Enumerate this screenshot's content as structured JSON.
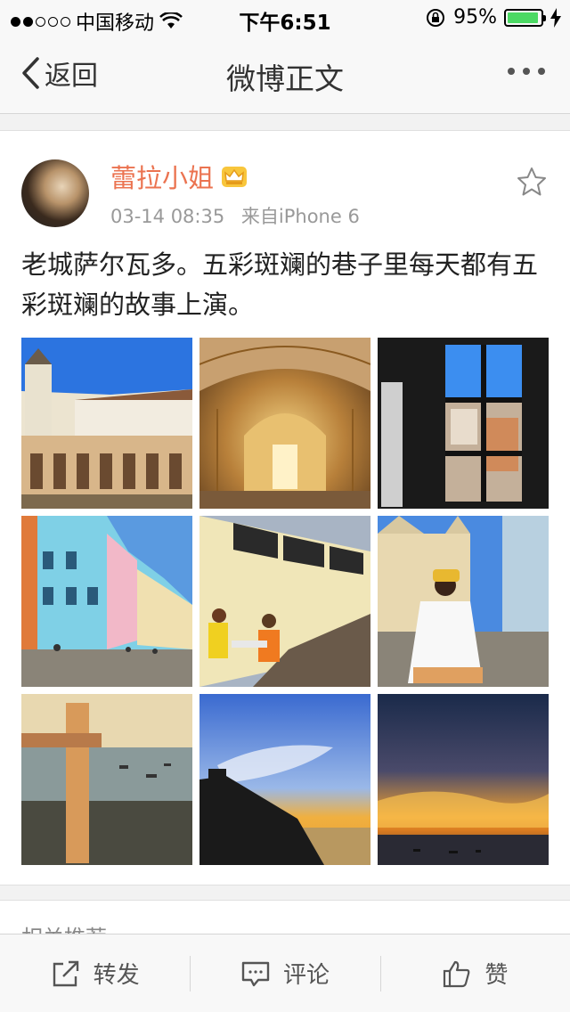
{
  "status_bar": {
    "carrier": "中国移动",
    "time": "下午6:51",
    "battery_percent": "95%",
    "battery_level": 0.95
  },
  "nav": {
    "back_label": "返回",
    "title": "微博正文"
  },
  "post": {
    "username": "蕾拉小姐",
    "date": "03-14 08:35",
    "source": "来自iPhone 6",
    "text": "老城萨尔瓦多。五彩斑斓的巷子里每天都有五彩斑斓的故事上演。",
    "photos": [
      {
        "name": "photo-colonial-church-courtyard"
      },
      {
        "name": "photo-golden-church-interior"
      },
      {
        "name": "photo-window-view"
      },
      {
        "name": "photo-colorful-street"
      },
      {
        "name": "photo-men-sitting-yellow-wall"
      },
      {
        "name": "photo-baiana-woman"
      },
      {
        "name": "photo-elevator-tower-bay"
      },
      {
        "name": "photo-sunset-coast"
      },
      {
        "name": "photo-sunset-sea"
      }
    ]
  },
  "recommend": {
    "label": "相关推荐"
  },
  "actions": {
    "repost": "转发",
    "comment": "评论",
    "like": "赞"
  },
  "colors": {
    "username": "#eb7350",
    "battery": "#4cd964"
  }
}
